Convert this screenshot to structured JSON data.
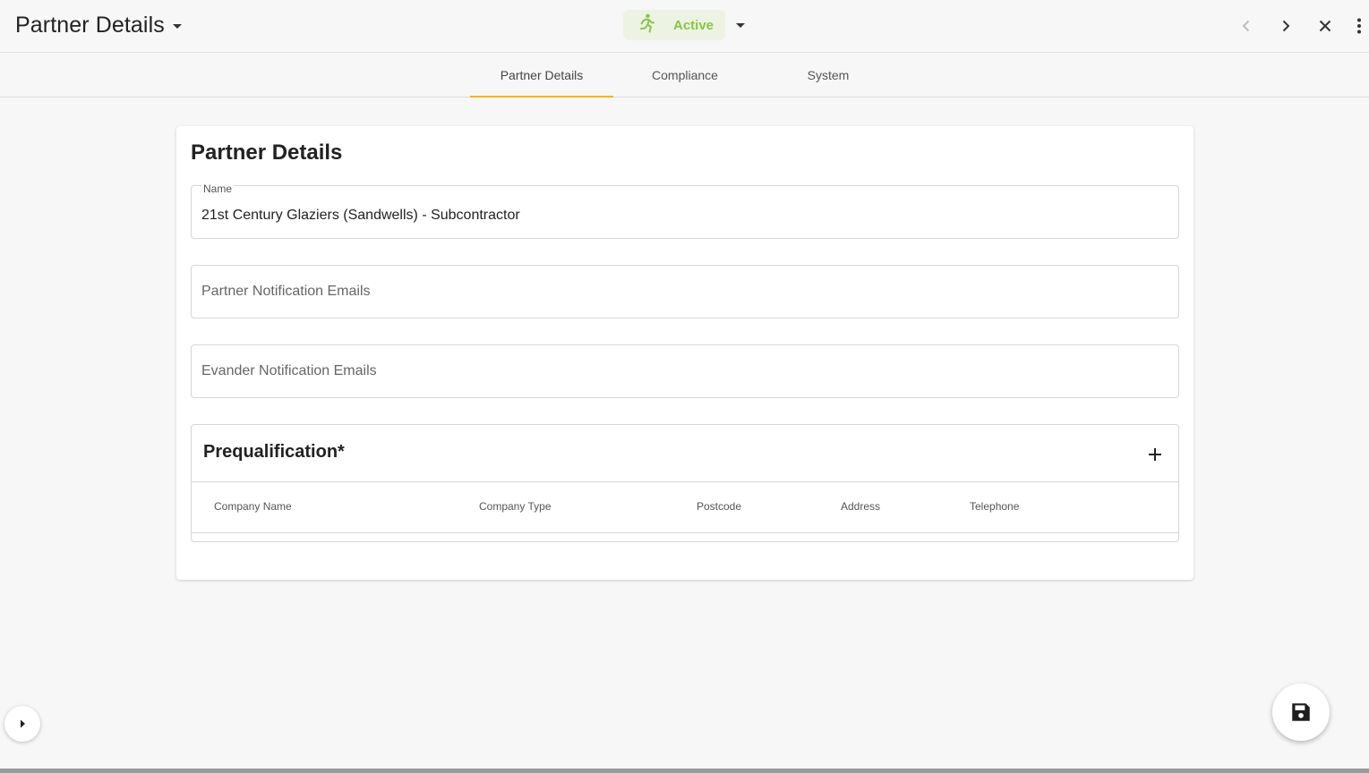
{
  "header": {
    "title": "Partner Details",
    "status": {
      "label": "Active",
      "color": "#8bc34a",
      "icon": "running-person-icon"
    },
    "actions": [
      {
        "name": "previous-record-button",
        "icon": "chevron-left-icon"
      },
      {
        "name": "next-record-button",
        "icon": "chevron-right-icon"
      },
      {
        "name": "close-button",
        "icon": "close-icon"
      },
      {
        "name": "more-options-button",
        "icon": "more-vert-icon"
      }
    ]
  },
  "tabs": [
    {
      "label": "Partner Details",
      "active": true
    },
    {
      "label": "Compliance",
      "active": false
    },
    {
      "label": "System",
      "active": false
    }
  ],
  "accent_color": "#f0b429",
  "form": {
    "title": "Partner Details",
    "name_field": {
      "label": "Name",
      "value": "21st Century Glaziers (Sandwells) - Subcontractor"
    },
    "partner_emails_field": {
      "placeholder": "Partner Notification Emails"
    },
    "evander_emails_field": {
      "placeholder": "Evander Notification Emails"
    }
  },
  "prequalification": {
    "title": "Prequalification*",
    "columns": [
      "Company Name",
      "Company Type",
      "Postcode",
      "Address",
      "Telephone"
    ],
    "rows": []
  },
  "controls": {
    "sidebar_toggle_icon": "triangle-right-icon",
    "save_icon": "floppy-disk-icon"
  }
}
